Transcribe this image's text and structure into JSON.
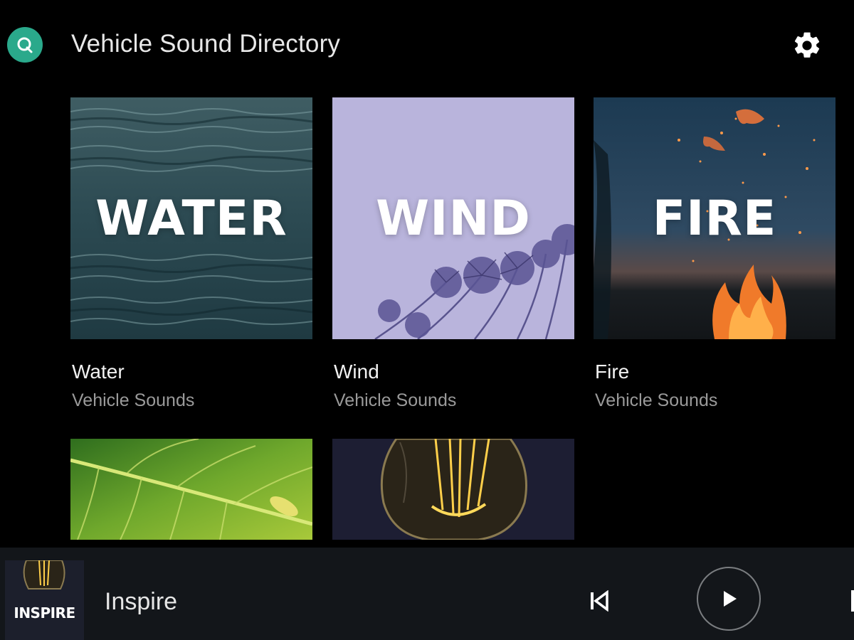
{
  "header": {
    "title": "Vehicle Sound Directory",
    "logo_icon": "search-logo-icon",
    "settings_icon": "gear-icon"
  },
  "colors": {
    "background": "#000000",
    "accent": "#2aa98b",
    "player_bar": "#13161a",
    "subtitle": "#9a9a9a"
  },
  "grid": {
    "tiles": [
      {
        "art_word": "WATER",
        "title": "Water",
        "subtitle": "Vehicle Sounds"
      },
      {
        "art_word": "WIND",
        "title": "Wind",
        "subtitle": "Vehicle Sounds"
      },
      {
        "art_word": "FIRE",
        "title": "Fire",
        "subtitle": "Vehicle Sounds"
      },
      {
        "art_word": "",
        "title": "",
        "subtitle": ""
      },
      {
        "art_word": "",
        "title": "",
        "subtitle": ""
      }
    ]
  },
  "player": {
    "art_word": "INSPIRE",
    "track_title": "Inspire",
    "prev_icon": "skip-previous-icon",
    "play_icon": "play-icon",
    "next_icon": "skip-next-icon"
  }
}
